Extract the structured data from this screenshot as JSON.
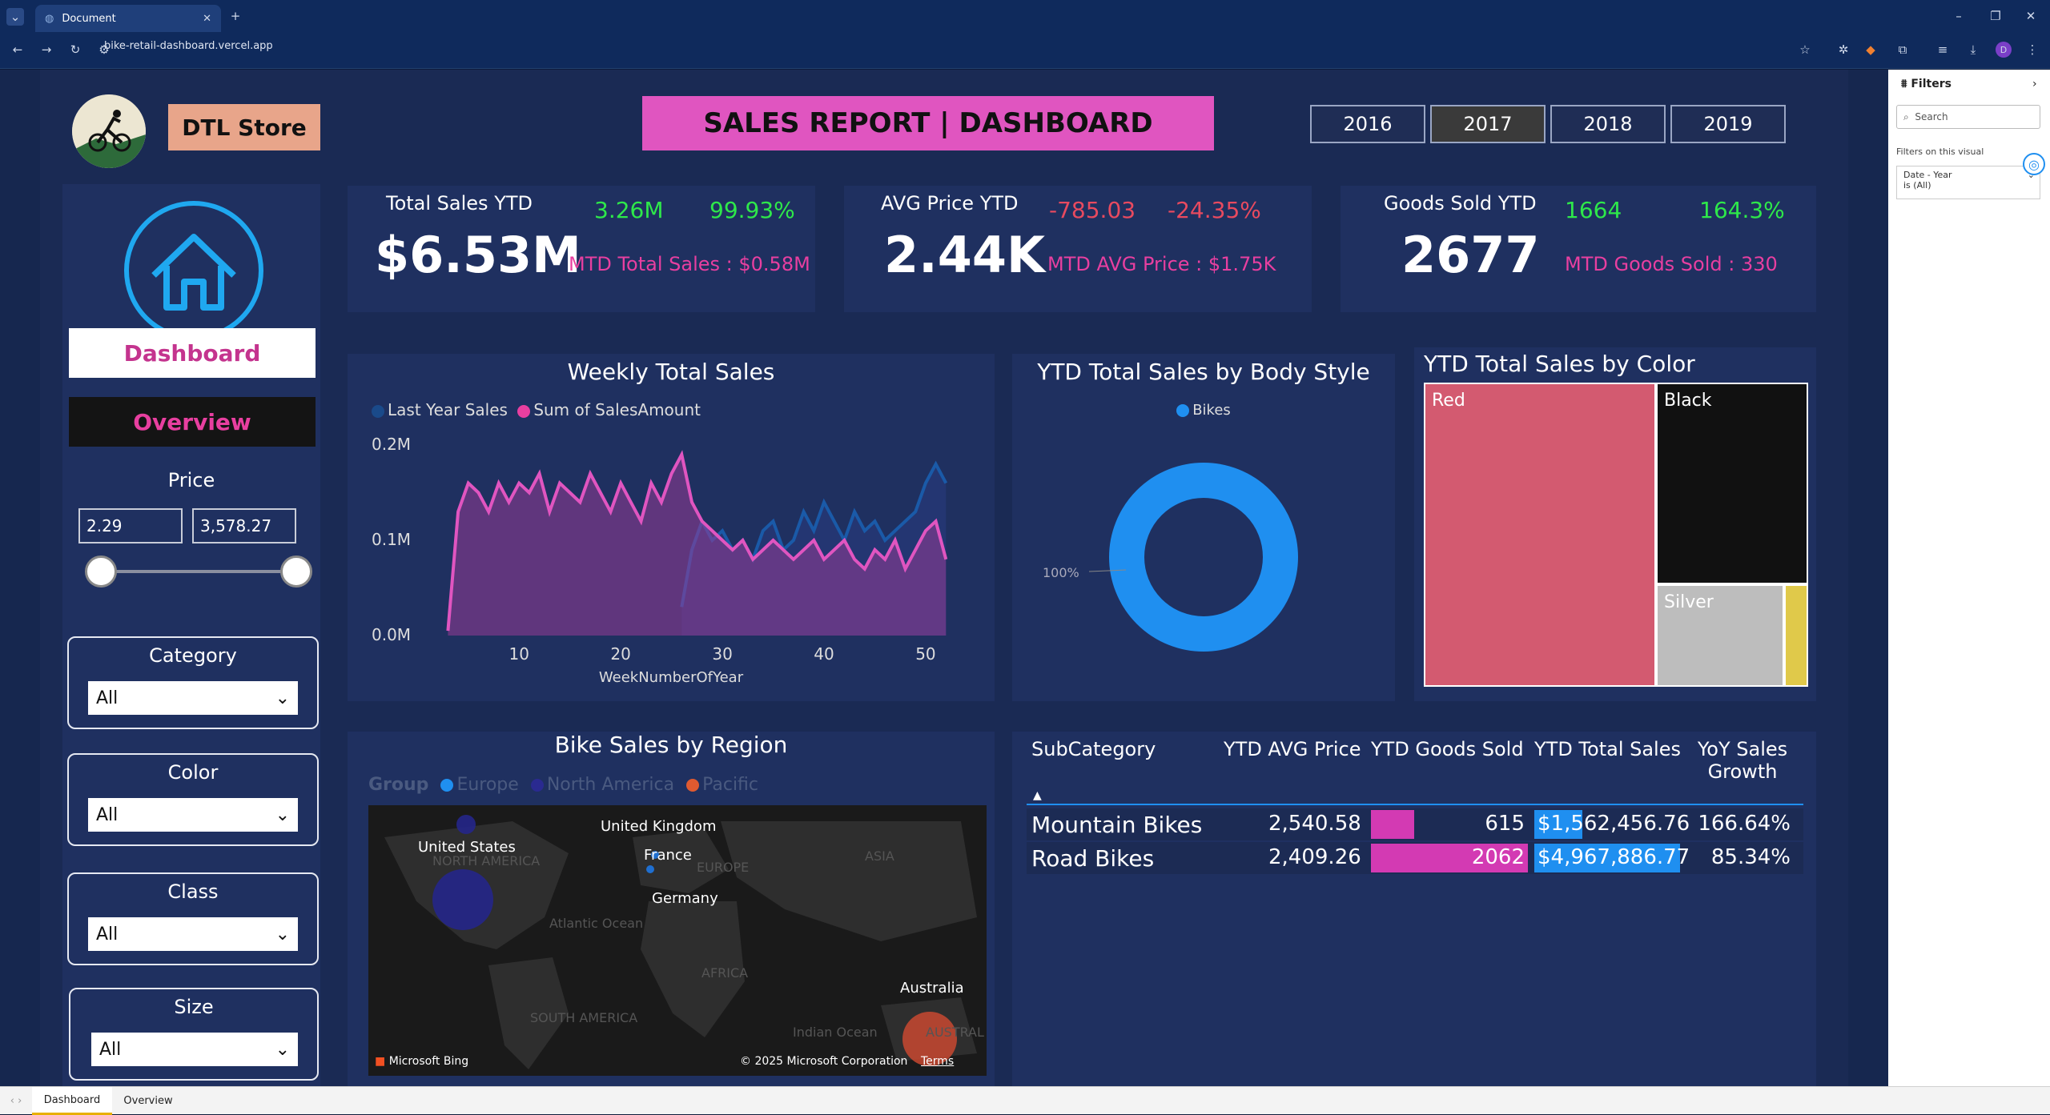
{
  "browser": {
    "tab_title": "Document",
    "url": "bike-retail-dashboard.vercel.app",
    "avatar": "D"
  },
  "header": {
    "store_label": "DTL Store",
    "title": "SALES REPORT | DASHBOARD",
    "years": [
      "2016",
      "2017",
      "2018",
      "2019"
    ],
    "selected_year": "2017"
  },
  "nav": {
    "dashboard": "Dashboard",
    "overview": "Overview"
  },
  "price": {
    "label": "Price",
    "min": "2.29",
    "max": "3,578.27"
  },
  "filters": [
    {
      "label": "Category",
      "value": "All"
    },
    {
      "label": "Color",
      "value": "All"
    },
    {
      "label": "Class",
      "value": "All"
    },
    {
      "label": "Size",
      "value": "All"
    }
  ],
  "kpi": {
    "sales": {
      "label": "Total Sales YTD",
      "value": "$6.53M",
      "delta": "3.26M",
      "pct": "99.93%",
      "mtd": "MTD Total Sales : $0.58M"
    },
    "price": {
      "label": "AVG Price YTD",
      "value": "2.44K",
      "delta": "-785.03",
      "pct": "-24.35%",
      "mtd": "MTD AVG Price : $1.75K"
    },
    "goods": {
      "label": "Goods Sold YTD",
      "value": "2677",
      "delta": "1664",
      "pct": "164.3%",
      "mtd": "MTD Goods Sold : 330"
    }
  },
  "weekly": {
    "title": "Weekly Total Sales",
    "legend": [
      "Last Year Sales",
      "Sum of SalesAmount"
    ],
    "yticks": [
      "0.2M",
      "0.1M",
      "0.0M"
    ],
    "xticks": [
      "10",
      "20",
      "30",
      "40",
      "50"
    ],
    "xlabel": "WeekNumberOfYear"
  },
  "donut": {
    "title": "YTD Total Sales by Body Style",
    "legend": "Bikes",
    "label": "100%"
  },
  "treemap": {
    "title": "YTD Total Sales by Color",
    "cells": [
      "Red",
      "Black",
      "Silver"
    ]
  },
  "region": {
    "title": "Bike Sales by Region",
    "legend_title": "Group",
    "legend": [
      "Europe",
      "North America",
      "Pacific"
    ],
    "places": [
      "United States",
      "United Kingdom",
      "France",
      "Germany",
      "Australia"
    ],
    "geo": [
      "NORTH AMERICA",
      "EUROPE",
      "ASIA",
      "Atlantic Ocean",
      "AFRICA",
      "SOUTH AMERICA",
      "Indian Ocean",
      "AUSTRAL"
    ],
    "bing": "Microsoft Bing",
    "copyright": "© 2025 Microsoft Corporation",
    "terms": "Terms"
  },
  "table": {
    "headers": [
      "SubCategory",
      "YTD AVG Price",
      "YTD Goods Sold",
      "YTD Total Sales",
      "YoY Sales",
      "Growth"
    ],
    "rows": [
      {
        "sub": "Mountain Bikes",
        "avg": "2,540.58",
        "goods": "615",
        "total": "$1,562,456.76",
        "yoy": "166.64%"
      },
      {
        "sub": "Road Bikes",
        "avg": "2,409.26",
        "goods": "2062",
        "total": "$4,967,886.77",
        "yoy": "85.34%"
      }
    ]
  },
  "filters_pane": {
    "title": "Filters",
    "search": "Search",
    "on_visual": "Filters on this visual",
    "field": "Date - Year",
    "field_value": "is (All)"
  },
  "pages": [
    "Dashboard",
    "Overview"
  ],
  "chart_data": [
    {
      "type": "area",
      "title": "Weekly Total Sales",
      "xlabel": "WeekNumberOfYear",
      "ylabel": "",
      "ylim": [
        0,
        0.2
      ],
      "y_unit": "M",
      "series": [
        {
          "name": "Sum of SalesAmount",
          "x": [
            3,
            4,
            5,
            6,
            7,
            8,
            9,
            10,
            11,
            12,
            13,
            14,
            15,
            16,
            17,
            18,
            19,
            20,
            21,
            22,
            23,
            24,
            25,
            26,
            27,
            28,
            29,
            30,
            31,
            32,
            33,
            34,
            35,
            36,
            37,
            38,
            39,
            40,
            41,
            42,
            43,
            44,
            45,
            46,
            47,
            48,
            49,
            50,
            51,
            52
          ],
          "values": [
            0.005,
            0.13,
            0.16,
            0.15,
            0.13,
            0.16,
            0.14,
            0.16,
            0.15,
            0.17,
            0.13,
            0.16,
            0.15,
            0.14,
            0.17,
            0.15,
            0.13,
            0.16,
            0.14,
            0.12,
            0.16,
            0.14,
            0.17,
            0.19,
            0.14,
            0.12,
            0.11,
            0.1,
            0.09,
            0.1,
            0.08,
            0.09,
            0.1,
            0.09,
            0.08,
            0.09,
            0.1,
            0.08,
            0.09,
            0.1,
            0.08,
            0.07,
            0.09,
            0.08,
            0.1,
            0.07,
            0.09,
            0.11,
            0.12,
            0.08
          ]
        },
        {
          "name": "Last Year Sales",
          "x": [
            26,
            27,
            28,
            29,
            30,
            31,
            32,
            33,
            34,
            35,
            36,
            37,
            38,
            39,
            40,
            41,
            42,
            43,
            44,
            45,
            46,
            47,
            48,
            49,
            50,
            51,
            52
          ],
          "values": [
            0.03,
            0.09,
            0.12,
            0.1,
            0.11,
            0.09,
            0.1,
            0.08,
            0.11,
            0.12,
            0.09,
            0.1,
            0.13,
            0.11,
            0.14,
            0.12,
            0.1,
            0.13,
            0.11,
            0.12,
            0.1,
            0.11,
            0.12,
            0.13,
            0.16,
            0.18,
            0.16
          ]
        }
      ]
    },
    {
      "type": "pie",
      "title": "YTD Total Sales by Body Style",
      "categories": [
        "Bikes"
      ],
      "values": [
        100
      ]
    },
    {
      "type": "treemap",
      "title": "YTD Total Sales by Color",
      "categories": [
        "Red",
        "Black",
        "Silver",
        "Yellow"
      ],
      "values": [
        0.5,
        0.3,
        0.15,
        0.05
      ]
    },
    {
      "type": "table",
      "title": "",
      "columns": [
        "SubCategory",
        "YTD AVG Price",
        "YTD Goods Sold",
        "YTD Total Sales",
        "YoY Sales Growth"
      ],
      "rows": [
        [
          "Mountain Bikes",
          2540.58,
          615,
          1562456.76,
          166.64
        ],
        [
          "Road Bikes",
          2409.26,
          2062,
          4967886.77,
          85.34
        ]
      ]
    }
  ],
  "colors": {
    "pink": "#e83fa0",
    "blue": "#1f8ff0",
    "green": "#2ee84a",
    "red": "#e84a5f"
  }
}
